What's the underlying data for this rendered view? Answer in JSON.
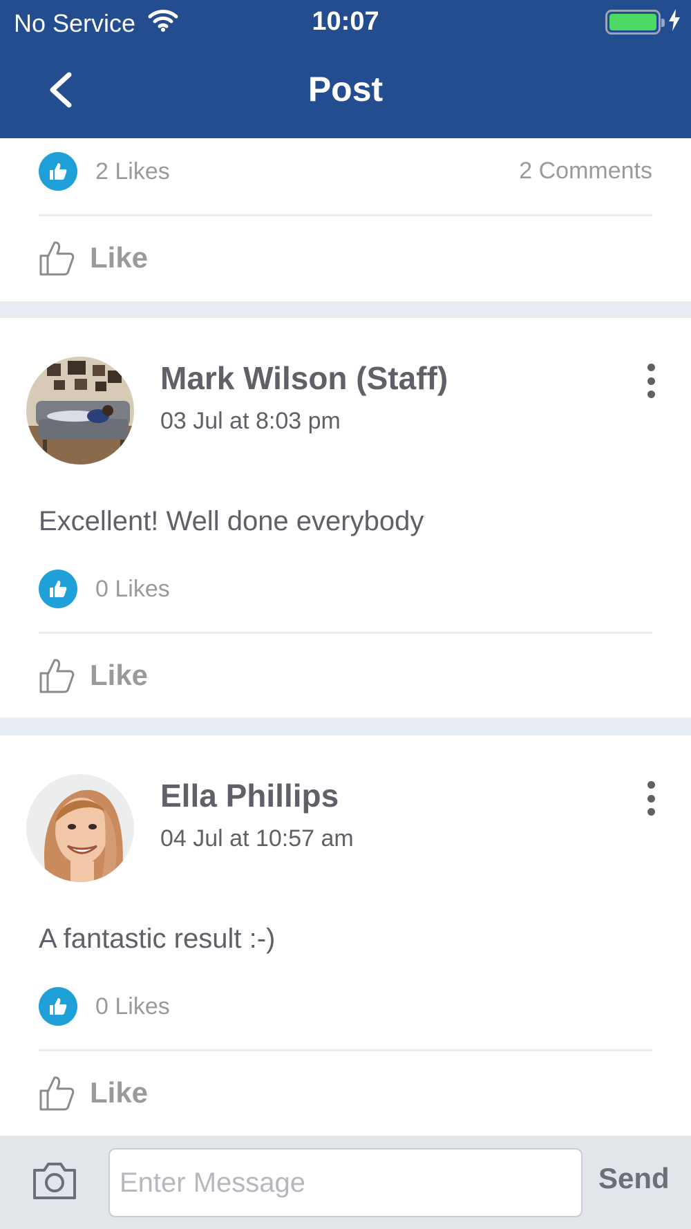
{
  "status_bar": {
    "carrier": "No Service",
    "time": "10:07",
    "battery_level": 1.0,
    "charging": true
  },
  "nav": {
    "title": "Post",
    "back_icon": "chevron-left-icon"
  },
  "post_summary": {
    "likes": "2 Likes",
    "comments": "2 Comments",
    "like_action": "Like"
  },
  "comments": [
    {
      "author": "Mark Wilson (Staff)",
      "time": "03 Jul at 8:03 pm",
      "text": "Excellent! Well done everybody",
      "likes": "0 Likes",
      "like_action": "Like",
      "avatar": "photo-child-on-sofa"
    },
    {
      "author": "Ella Phillips",
      "time": "04 Jul at 10:57 am",
      "text": "A fantastic result :-)",
      "likes": "0 Likes",
      "like_action": "Like",
      "avatar": "photo-smiling-woman"
    }
  ],
  "composer": {
    "placeholder": "Enter Message",
    "send_label": "Send",
    "camera_icon": "camera-icon"
  },
  "colors": {
    "header": "#234d8e",
    "like_badge": "#1fa0d8",
    "separator": "#e8ecf3",
    "composer_bg": "#e2e5ea"
  }
}
